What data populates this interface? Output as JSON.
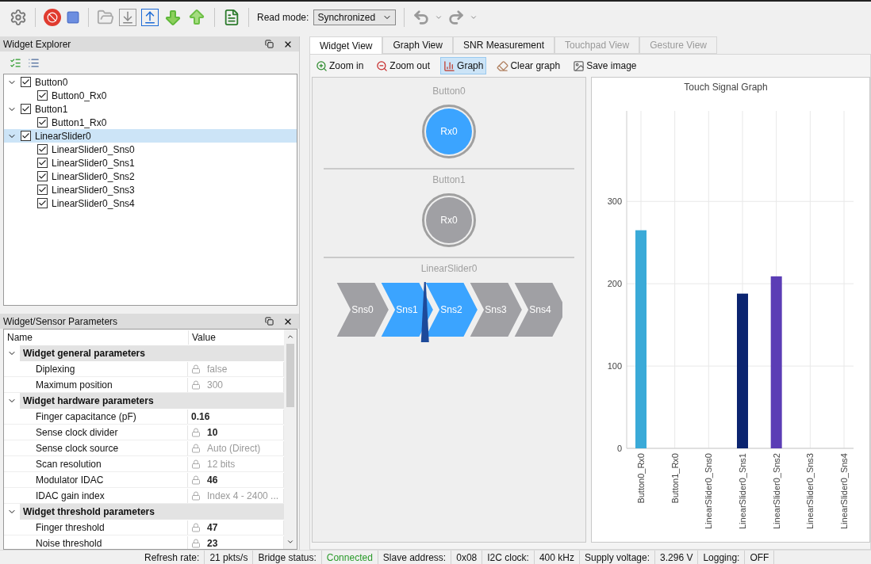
{
  "toolbar": {
    "read_mode_label": "Read mode:",
    "read_mode": "Synchronized"
  },
  "widget_explorer": {
    "title": "Widget Explorer",
    "tree": [
      {
        "label": "Button0",
        "checked": true,
        "expanded": true,
        "selected": false,
        "children": [
          {
            "label": "Button0_Rx0",
            "checked": true,
            "selected": false
          }
        ]
      },
      {
        "label": "Button1",
        "checked": true,
        "expanded": true,
        "selected": false,
        "children": [
          {
            "label": "Button1_Rx0",
            "checked": true,
            "selected": false
          }
        ]
      },
      {
        "label": "LinearSlider0",
        "checked": true,
        "expanded": true,
        "selected": true,
        "children": [
          {
            "label": "LinearSlider0_Sns0",
            "checked": true,
            "selected": false
          },
          {
            "label": "LinearSlider0_Sns1",
            "checked": true,
            "selected": false
          },
          {
            "label": "LinearSlider0_Sns2",
            "checked": true,
            "selected": false
          },
          {
            "label": "LinearSlider0_Sns3",
            "checked": true,
            "selected": false
          },
          {
            "label": "LinearSlider0_Sns4",
            "checked": true,
            "selected": false
          }
        ]
      }
    ]
  },
  "parameters": {
    "title": "Widget/Sensor Parameters",
    "columns": [
      "Name",
      "Value"
    ],
    "groups": [
      {
        "label": "Widget general parameters",
        "expanded": true,
        "rows": [
          {
            "name": "Diplexing",
            "value": "false",
            "locked": true,
            "bold": false
          },
          {
            "name": "Maximum position",
            "value": "300",
            "locked": true,
            "bold": false
          }
        ]
      },
      {
        "label": "Widget hardware parameters",
        "expanded": true,
        "rows": [
          {
            "name": "Finger capacitance (pF)",
            "value": "0.16",
            "locked": false,
            "bold": true
          },
          {
            "name": "Sense clock divider",
            "value": "10",
            "locked": true,
            "bold": true
          },
          {
            "name": "Sense clock source",
            "value": "Auto (Direct)",
            "locked": true,
            "bold": false
          },
          {
            "name": "Scan resolution",
            "value": "12 bits",
            "locked": true,
            "bold": false
          },
          {
            "name": "Modulator IDAC",
            "value": "46",
            "locked": true,
            "bold": true
          },
          {
            "name": "IDAC gain index",
            "value": "Index 4 - 2400 ...",
            "locked": true,
            "bold": false
          }
        ]
      },
      {
        "label": "Widget threshold parameters",
        "expanded": true,
        "rows": [
          {
            "name": "Finger threshold",
            "value": "47",
            "locked": true,
            "bold": true
          },
          {
            "name": "Noise threshold",
            "value": "23",
            "locked": true,
            "bold": true
          }
        ]
      }
    ]
  },
  "tabs": [
    {
      "label": "Widget View",
      "selected": true,
      "disabled": false
    },
    {
      "label": "Graph View",
      "selected": false,
      "disabled": false
    },
    {
      "label": "SNR Measurement",
      "selected": false,
      "disabled": false
    },
    {
      "label": "Touchpad View",
      "selected": false,
      "disabled": true
    },
    {
      "label": "Gesture View",
      "selected": false,
      "disabled": true
    }
  ],
  "view_toolbar": [
    {
      "kind": "zoom_in",
      "label": "Zoom in",
      "selected": false
    },
    {
      "kind": "zoom_out",
      "label": "Zoom out",
      "selected": false
    },
    {
      "kind": "graph",
      "label": "Graph",
      "selected": true
    },
    {
      "kind": "clear",
      "label": "Clear graph",
      "selected": false
    },
    {
      "kind": "save",
      "label": "Save image",
      "selected": false
    }
  ],
  "widget_view": {
    "buttons": [
      {
        "title": "Button0",
        "sensor": "Rx0",
        "active": true
      },
      {
        "title": "Button1",
        "sensor": "Rx0",
        "active": false
      }
    ],
    "slider": {
      "title": "LinearSlider0",
      "level": 0.375,
      "segments": [
        {
          "label": "Sns0",
          "active": false
        },
        {
          "label": "Sns1",
          "active": true
        },
        {
          "label": "Sns2",
          "active": true
        },
        {
          "label": "Sns3",
          "active": false
        },
        {
          "label": "Sns4",
          "active": false
        }
      ]
    }
  },
  "graph": {
    "chart_data": {
      "type": "bar",
      "title": "Touch Signal Graph",
      "categories": [
        "Button0_Rx0",
        "Button1_Rx0",
        "LinearSlider0_Sns0",
        "LinearSlider0_Sns1",
        "LinearSlider0_Sns2",
        "LinearSlider0_Sns3",
        "LinearSlider0_Sns4"
      ],
      "ylim": [
        0,
        410
      ],
      "yticks": [
        0,
        100,
        200,
        300
      ],
      "grid": true,
      "series": [
        {
          "color": "#3aaad8",
          "values": [
            265,
            null,
            null,
            null,
            null,
            null,
            null
          ]
        },
        {
          "color": "#0b2470",
          "values": [
            null,
            null,
            null,
            188,
            null,
            null,
            null
          ]
        },
        {
          "color": "#5b3db5",
          "values": [
            null,
            null,
            null,
            null,
            209,
            null,
            null
          ]
        }
      ]
    }
  },
  "status_bar": [
    {
      "label": "Refresh rate:",
      "value": "21 pkts/s",
      "ok": false
    },
    {
      "label": "Bridge status:",
      "value": "Connected",
      "ok": true
    },
    {
      "label": "Slave address:",
      "value": "0x08",
      "ok": false
    },
    {
      "label": "I2C clock:",
      "value": "400 kHz",
      "ok": false
    },
    {
      "label": "Supply voltage:",
      "value": "3.296 V",
      "ok": false
    },
    {
      "label": "Logging:",
      "value": "OFF",
      "ok": false
    }
  ]
}
